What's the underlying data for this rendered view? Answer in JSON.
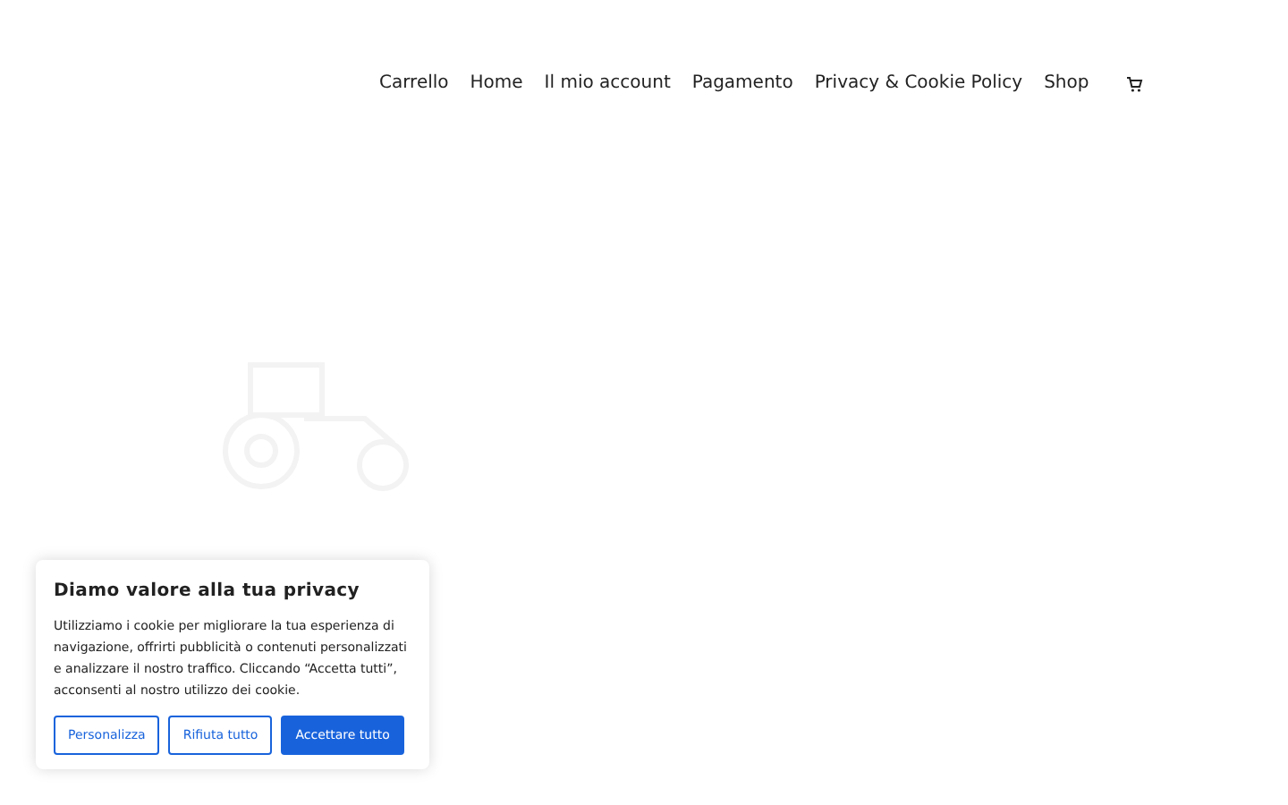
{
  "nav": {
    "items": [
      "Carrello",
      "Home",
      "Il mio account",
      "Pagamento",
      "Privacy & Cookie Policy",
      "Shop"
    ]
  },
  "cookie_banner": {
    "title": "Diamo valore alla tua privacy",
    "text": "Utilizziamo i cookie per migliorare la tua esperienza di navigazione, offrirti pubblicità o contenuti personalizzati e analizzare il nostro traffico. Cliccando “Accetta tutti”, acconsenti al nostro utilizzo dei cookie.",
    "buttons": [
      {
        "label": "Personalizza",
        "kind": "outline"
      },
      {
        "label": "Rifiuta tutto",
        "kind": "outline"
      },
      {
        "label": "Accettare tutto",
        "kind": "primary"
      }
    ]
  }
}
